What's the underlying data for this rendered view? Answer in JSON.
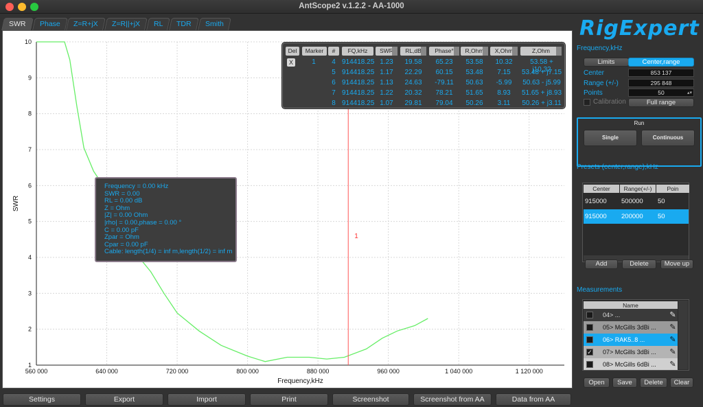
{
  "window": {
    "title": "AntScope2 v.1.2.2 - AA-1000"
  },
  "tabs": [
    "SWR",
    "Phase",
    "Z=R+jX",
    "Z=R||+jX",
    "RL",
    "TDR",
    "Smith"
  ],
  "colors": {
    "accent": "#19aaf0",
    "curve": "#66ee66",
    "marker_line": "#ff5555"
  },
  "chart_data": {
    "type": "line",
    "xlabel": "Frequency,kHz",
    "ylabel": "SWR",
    "xlim": [
      560000,
      1160000
    ],
    "ylim": [
      1,
      10
    ],
    "x_ticks": [
      "560 000",
      "640 000",
      "720 000",
      "800 000",
      "880 000",
      "960 000",
      "1 040 000",
      "1 120 000"
    ],
    "y_ticks": [
      "1",
      "2",
      "3",
      "4",
      "5",
      "6",
      "7",
      "8",
      "9",
      "10"
    ],
    "grid": true,
    "series": [
      {
        "x": [
          560000,
          592000,
          598000,
          606000,
          614000,
          625000,
          640000,
          655000,
          670000,
          690000,
          705000,
          720000,
          745000,
          770000,
          800000,
          820000,
          845000,
          870000,
          890000,
          910000,
          935000,
          953000,
          970000,
          990000,
          1005000
        ],
        "y": [
          10.0,
          10.0,
          9.5,
          8.2,
          7.05,
          6.4,
          5.85,
          5.0,
          4.2,
          3.6,
          3.0,
          2.45,
          1.95,
          1.55,
          1.25,
          1.1,
          1.22,
          1.22,
          1.17,
          1.22,
          1.45,
          1.75,
          1.95,
          2.1,
          2.3
        ]
      }
    ],
    "marker": {
      "x": 914418.25,
      "label": "1"
    }
  },
  "marker_table": {
    "headers": [
      "Del",
      "Marker",
      "#",
      "FQ,kHz",
      "SWR",
      "RL,dB",
      "Phase°",
      "R,Ohm",
      "X,Ohm",
      "Z,Ohm"
    ],
    "del_button": "X",
    "marker_number": "1",
    "rows": [
      [
        "4",
        "914418.25",
        "1.23",
        "19.58",
        "65.23",
        "53.58",
        "10.32",
        "53.58 + j10.32"
      ],
      [
        "5",
        "914418.25",
        "1.17",
        "22.29",
        "60.15",
        "53.48",
        "7.15",
        "53.48 + j7.15"
      ],
      [
        "6",
        "914418.25",
        "1.13",
        "24.63",
        "-79.11",
        "50.63",
        "-5.99",
        "50.63 - j5.99"
      ],
      [
        "7",
        "914418.25",
        "1.22",
        "20.32",
        "78.21",
        "51.65",
        "8.93",
        "51.65 + j8.93"
      ],
      [
        "8",
        "914418.25",
        "1.07",
        "29.81",
        "79.04",
        "50.26",
        "3.11",
        "50.26 + j3.11"
      ]
    ]
  },
  "tooltip": {
    "lines": [
      "Frequency = 0.00 kHz",
      "SWR = 0.00",
      "RL = 0.00 dB",
      "Z =  Ohm",
      "|Z| = 0.00 Ohm",
      "|rho| = 0.00,phase = 0.00 °",
      "C = 0.00 pF",
      "Zpar =  Ohm",
      "Cpar = 0.00 pF",
      "Cable: length(1/4) = inf m,length(1/2) = inf m"
    ]
  },
  "bottom_buttons": [
    "Settings",
    "Export",
    "Import",
    "Print",
    "Screenshot",
    "Screenshot from AA",
    "Data from AA"
  ],
  "right_panel": {
    "logo": "RigExpert",
    "frequency_title": "Frequency,kHz",
    "limits_button": "Limits",
    "center_range_button": "Center,range",
    "center_label": "Center",
    "center_value": "853 137",
    "range_label": "Range (+/-)",
    "range_value": "295 848",
    "points_label": "Points",
    "points_value": "50",
    "calibration_label": "Calibration",
    "full_range_button": "Full range",
    "run_title": "Run",
    "single_button": "Single",
    "continuous_button": "Continuous",
    "presets_title": "Presets (center,range),kHz",
    "presets_headers": [
      "Center",
      "Range(+/-)",
      "Poin"
    ],
    "presets_rows": [
      [
        "915000",
        "500000",
        "50"
      ],
      [
        "915000",
        "200000",
        "50"
      ]
    ],
    "add_button": "Add",
    "delete_button": "Delete",
    "move_up_button": "Move up",
    "measurements_title": "Measurements",
    "measurements_header": "Name",
    "measurements": [
      "04> ...",
      "05> McGills 3dBi ...",
      "06> RAK5..8 ...",
      "07> McGills 3dBi ...",
      "08> McGills 6dBi ..."
    ],
    "open_button": "Open",
    "save_button": "Save",
    "delete_meas_button": "Delete",
    "clear_button": "Clear"
  }
}
